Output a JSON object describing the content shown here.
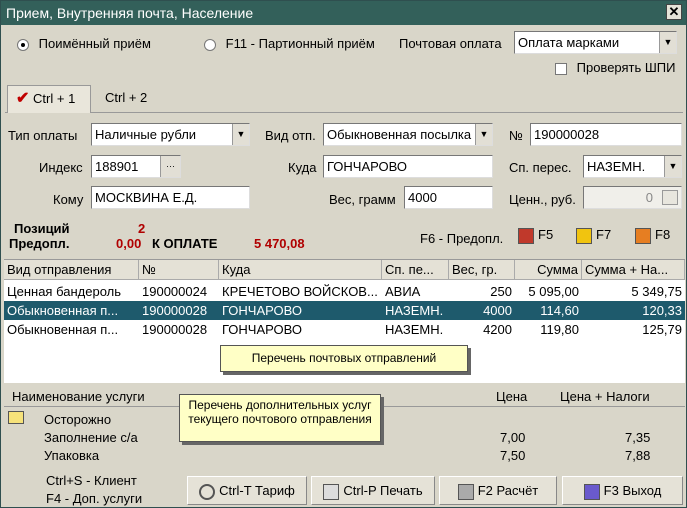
{
  "window": {
    "title": "Прием, Внутренняя почта, Население",
    "close": "✕"
  },
  "mode": {
    "individual_label": "Поимённый приём",
    "batch_label": "F11 - Партионный приём",
    "postage_label": "Почтовая оплата",
    "postage_value": "Оплата марками",
    "check_shpi_label": "Проверять ШПИ"
  },
  "tabs": [
    {
      "label": "Ctrl + 1"
    },
    {
      "label": "Ctrl + 2"
    }
  ],
  "form": {
    "pay_type_label": "Тип оплаты",
    "pay_type_value": "Наличные рубли",
    "kind_label": "Вид отп.",
    "kind_value": "Обыкновенная посылка",
    "num_label": "№",
    "num_value": "190000028",
    "index_label": "Индекс",
    "index_value": "188901",
    "index_btn": "···",
    "where_label": "Куда",
    "where_value": "ГОНЧАРОВО",
    "method_label": "Сп. перес.",
    "method_value": "НАЗЕМН.",
    "to_label": "Кому",
    "to_value": "МОСКВИНА Е.Д.",
    "weight_label": "Вес, грамм",
    "weight_value": "4000",
    "value_label": "Ценн., руб.",
    "value_value": "0"
  },
  "summary": {
    "positions_label": "Позиций",
    "positions_value": "2",
    "prepaid_label": "Предопл.",
    "prepaid_value": "0,00",
    "to_pay_label": "К ОПЛАТЕ",
    "to_pay_value": "5 470,08",
    "f6_label": "F6 - Предопл.",
    "f5_label": "F5",
    "f7_label": "F7",
    "f8_label": "F8"
  },
  "table": {
    "headers": [
      "Вид отправления",
      "№",
      "Куда",
      "Сп. пе...",
      "Вес, гр.",
      "Сумма",
      "Сумма + На..."
    ],
    "rows": [
      [
        "Ценная бандероль",
        "190000024",
        "КРЕЧЕТОВО ВОЙСКОВ...",
        "АВИА",
        "250",
        "5 095,00",
        "5 349,75"
      ],
      [
        "Обыкновенная п...",
        "190000028",
        "ГОНЧАРОВО",
        "НАЗЕМН.",
        "4000",
        "114,60",
        "120,33"
      ],
      [
        "Обыкновенная п...",
        "190000028",
        "ГОНЧАРОВО",
        "НАЗЕМН.",
        "4200",
        "119,80",
        "125,79"
      ]
    ]
  },
  "callouts": {
    "items": "Перечень почтовых отправлений",
    "services": "Перечень дополнительных услуг текущего почтового отправления"
  },
  "services": {
    "headers": [
      "Наименование услуги",
      "Цена",
      "Цена + Налоги"
    ],
    "rows": [
      [
        "Осторожно",
        "",
        ""
      ],
      [
        "Заполнение с/а",
        "7,00",
        "7,35"
      ],
      [
        "Упаковка",
        "7,50",
        "7,88"
      ]
    ]
  },
  "footer": {
    "client_hint": "Ctrl+S - Клиент",
    "extra_hint": "F4 - Доп. услуги",
    "tariff_btn": "Ctrl-T  Тариф",
    "print_btn": "Ctrl-P  Печать",
    "calc_btn": "F2  Расчёт",
    "exit_btn": "F3  Выход"
  },
  "colors": {
    "title": "#33605a",
    "selection": "#1e5a6c",
    "total_red": "#b00000",
    "callout_bg": "#ffffc6"
  }
}
